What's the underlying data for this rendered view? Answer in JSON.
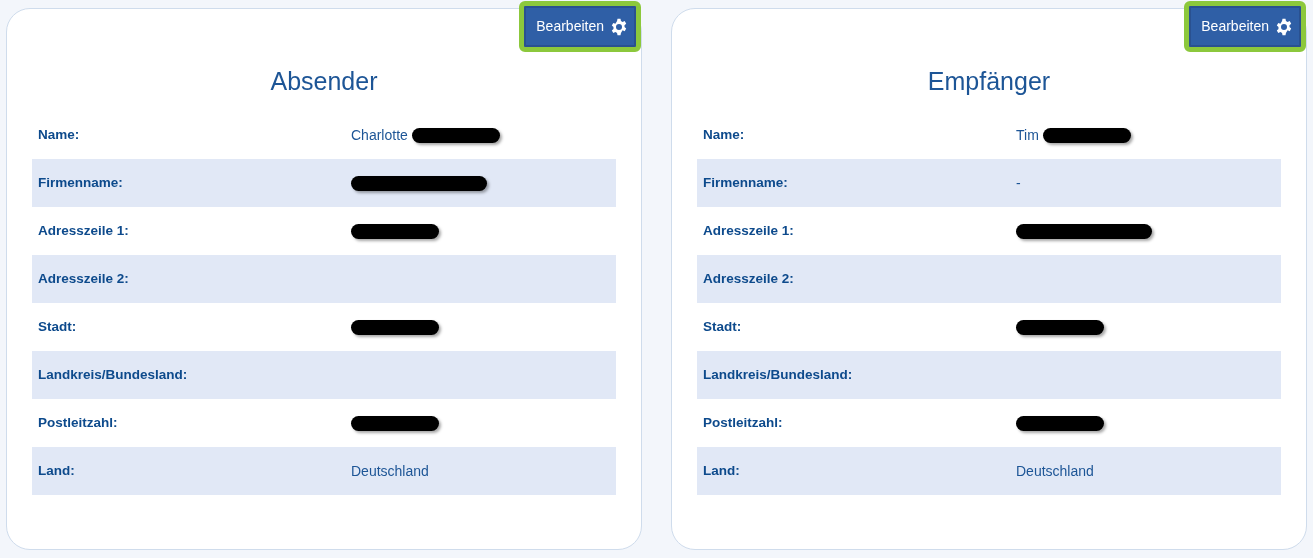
{
  "panels": [
    {
      "title": "Absender",
      "edit_button": {
        "label": "Bearbeiten",
        "highlighted": true
      },
      "rows": [
        {
          "label": "Name:",
          "value": "Charlotte",
          "redacted": true
        },
        {
          "label": "Firmenname:",
          "redacted": true,
          "wide": true
        },
        {
          "label": "Adresszeile 1:",
          "redacted": true
        },
        {
          "label": "Adresszeile 2:"
        },
        {
          "label": "Stadt:",
          "redacted": true
        },
        {
          "label": "Landkreis/Bundesland:"
        },
        {
          "label": "Postleitzahl:",
          "redacted": true
        },
        {
          "label": "Land:",
          "value": "Deutschland"
        }
      ]
    },
    {
      "title": "Empfänger",
      "edit_button": {
        "label": "Bearbeiten",
        "highlighted": true
      },
      "rows": [
        {
          "label": "Name:",
          "value": "Tim",
          "redacted": true
        },
        {
          "label": "Firmenname:",
          "value": "-"
        },
        {
          "label": "Adresszeile 1:",
          "redacted": true,
          "wide": true
        },
        {
          "label": "Adresszeile 2:"
        },
        {
          "label": "Stadt:",
          "redacted": true
        },
        {
          "label": "Landkreis/Bundesland:"
        },
        {
          "label": "Postleitzahl:",
          "redacted": true
        },
        {
          "label": "Land:",
          "value": "Deutschland"
        }
      ]
    }
  ]
}
